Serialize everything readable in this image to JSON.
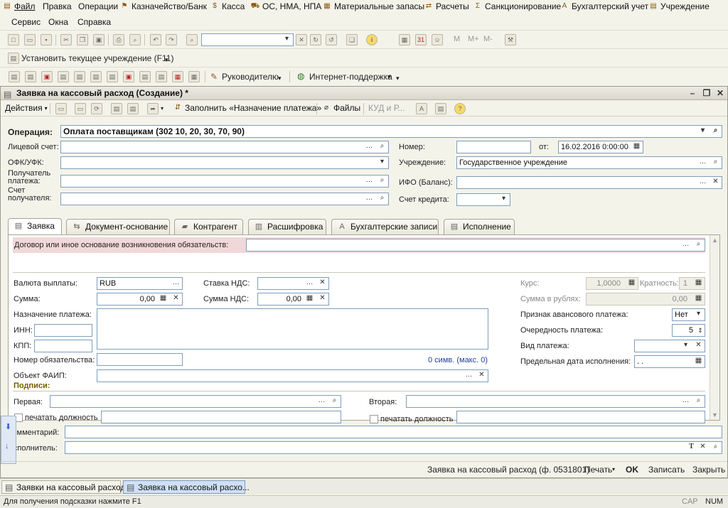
{
  "menu": [
    "Файл",
    "Правка",
    "Операции",
    "Казначейство/Банк",
    "Касса",
    "ОС, НМА, НПА",
    "Материальные запасы",
    "Расчеты",
    "Санкционирование",
    "Бухгалтерский учет",
    "Учреждение",
    "Сервис",
    "Окна",
    "Справка"
  ],
  "toolbar3": {
    "set_org": "Установить текущее учреждение (F11)"
  },
  "toolbar4": {
    "manager": "Руководителю",
    "support": "Интернет-поддержка"
  },
  "window": {
    "title": "Заявка на кассовый расход (Создание) *"
  },
  "actions": {
    "actions": "Действия",
    "fill": "Заполнить «Назначение платежа»",
    "files": "Файлы",
    "kud": "КУД и Р..."
  },
  "header": {
    "operation_label": "Операция:",
    "operation_value": "Оплата поставщикам (302 10, 20, 30, 70, 90)",
    "account_label": "Лицевой счет:",
    "ofk_label": "ОФК/УФК:",
    "recipient_label": "Получатель платежа:",
    "recipient_account_label": "Счет получателя:",
    "number_label": "Номер:",
    "from_label": "от:",
    "date_value": "16.02.2016  0:00:00",
    "org_label": "Учреждение:",
    "org_value": "Государственное учреждение",
    "ifo_label": "ИФО (Баланс):",
    "credit_label": "Счет кредита:"
  },
  "tabs": [
    "Заявка",
    "Документ-основание",
    "Контрагент",
    "Расшифровка",
    "Бухгалтерские записи",
    "Исполнение"
  ],
  "form": {
    "contract_label": "Договор или иное основание возникновения обязательств:",
    "currency_label": "Валюта выплаты:",
    "currency_value": "RUB",
    "vat_rate_label": "Ставка НДС:",
    "sum_label": "Сумма:",
    "sum_value": "0,00",
    "vat_sum_label": "Сумма НДС:",
    "vat_sum_value": "0,00",
    "purpose_label": "Назначение платежа:",
    "inn_label": "ИНН:",
    "kpp_label": "КПП:",
    "obligation_label": "Номер обязательства:",
    "chars_counter": "0 симв. (макс. 0)",
    "faip_label": "Объект ФАИП:",
    "rate_label": "Курс:",
    "rate_value": "1,0000",
    "multiplicity_label": "Кратность:",
    "multiplicity_value": "1",
    "rub_sum_label": "Сумма в рублях:",
    "rub_sum_value": "0,00",
    "advance_label": "Признак авансового платежа:",
    "advance_value": "Нет",
    "priority_label": "Очередность платежа:",
    "priority_value": "5",
    "pay_type_label": "Вид платежа:",
    "deadline_label": "Предельная дата исполнения:",
    "deadline_value": ". .",
    "signatures_label": "Подписи:",
    "first_label": "Первая:",
    "second_label": "Вторая:",
    "print_position": "печатать должность"
  },
  "footer_fields": {
    "comment_label": "Комментарий:",
    "executor_label": "Исполнитель:"
  },
  "bottom": {
    "form_name": "Заявка на кассовый расход (ф. 0531801)",
    "print": "Печать",
    "ok": "OK",
    "save": "Записать",
    "close": "Закрыть"
  },
  "taskbar": [
    "Заявки на кассовый расход",
    "Заявка на кассовый расхо..."
  ],
  "status": {
    "hint": "Для получения подсказки нажмите F1",
    "cap": "CAP",
    "num": "NUM"
  }
}
